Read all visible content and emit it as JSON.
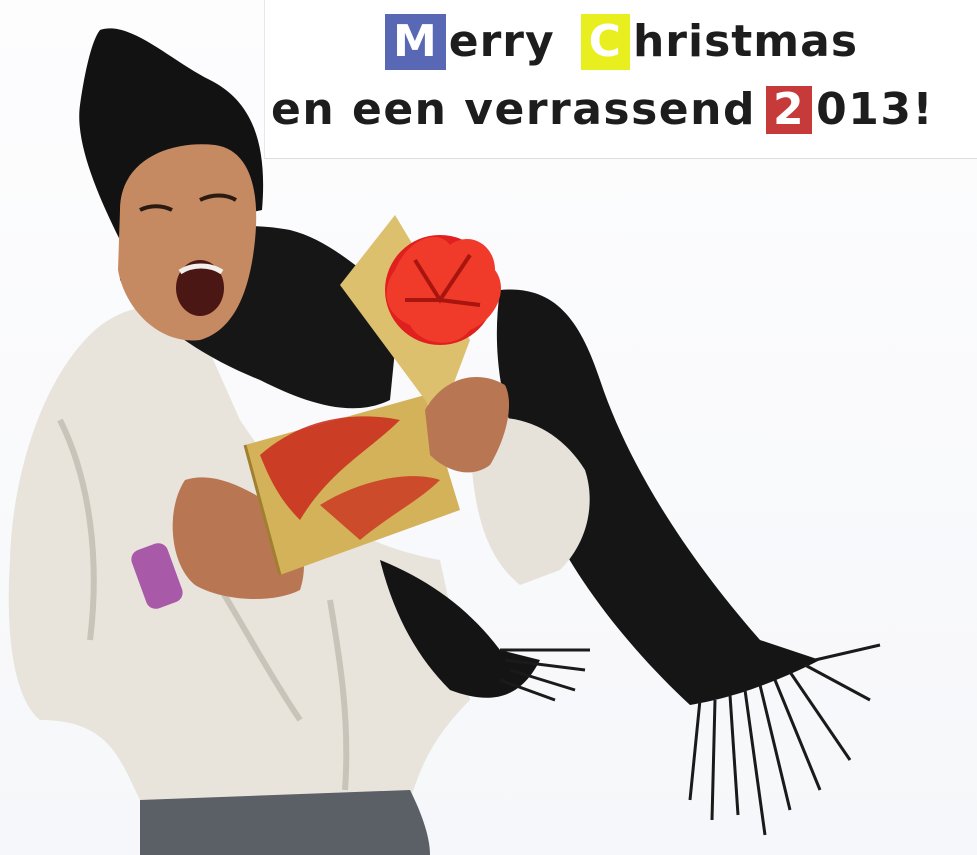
{
  "greeting": {
    "line1": {
      "initial_1": "M",
      "rest_1": "erry",
      "initial_2": "C",
      "rest_2": "hristmas"
    },
    "line2": {
      "text": "en een verrassend",
      "initial_year": "2",
      "rest_year": "013!"
    }
  },
  "colors": {
    "box_m": "#5868b5",
    "box_c": "#e9ef1f",
    "box_2": "#c73a3a",
    "gift_bow": "#e0201e",
    "gift_box": "#d4b25a",
    "jacket": "#e8e4dc",
    "scarf": "#141414"
  },
  "photo": {
    "subject": "person-in-winter-jacket-opening-gift",
    "icons": [
      "gift-box-icon",
      "ribbon-bow-icon"
    ]
  }
}
